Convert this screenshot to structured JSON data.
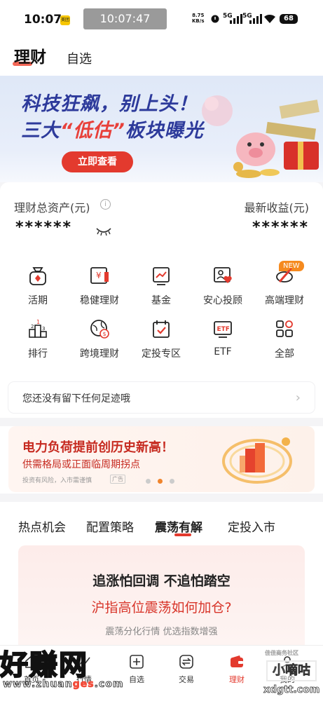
{
  "status_bar": {
    "time": "10:07",
    "badge": "美团",
    "clock_pill": "10:07:47",
    "net_speed_value": "8.75",
    "net_speed_unit": "KB/s",
    "sim1": "5G",
    "sim2": "5G",
    "battery": "68"
  },
  "header": {
    "tab_main": "理财",
    "tab_alt": "自选"
  },
  "banner": {
    "line1": "科技狂飙，别上头！",
    "line2_pre": "三大",
    "line2_hl": "“低估”",
    "line2_post": "板块曝光",
    "cta": "立即查看"
  },
  "assets": {
    "label": "理财总资产(元)",
    "value": "******",
    "income_label": "最新收益(元)",
    "income_value": "******"
  },
  "grid": {
    "new_badge": "NEW",
    "items": [
      {
        "label": "活期",
        "icon": "money-bag-icon"
      },
      {
        "label": "稳健理财",
        "icon": "yen-card-icon"
      },
      {
        "label": "基金",
        "icon": "chart-board-icon"
      },
      {
        "label": "安心投顾",
        "icon": "advisor-heart-icon"
      },
      {
        "label": "高端理财",
        "icon": "premium-rocket-icon"
      },
      {
        "label": "排行",
        "icon": "podium-icon"
      },
      {
        "label": "跨境理财",
        "icon": "globe-dollar-icon"
      },
      {
        "label": "定投专区",
        "icon": "calendar-check-icon"
      },
      {
        "label": "ETF",
        "icon": "etf-icon"
      },
      {
        "label": "全部",
        "icon": "all-apps-icon"
      }
    ]
  },
  "footprint": {
    "text": "您还没有留下任何足迹哦"
  },
  "promo": {
    "title": "电力负荷提前创历史新高！",
    "subtitle": "供需格局或正面临周期拐点",
    "disclaimer": "投资有风险，入市需谨慎",
    "ad_tag": "广告",
    "active_dot": 2
  },
  "section": {
    "tabs": [
      "热点机会",
      "配置策略",
      "震荡有解",
      "定投入市"
    ],
    "active_tab": 2,
    "card_title": "追涨怕回调 不追怕踏空",
    "card_subtitle": "沪指高位震荡如何加仓?",
    "card_desc": "震荡分化行情 优选指数增强"
  },
  "bottom_nav": {
    "items": [
      {
        "label": "首页",
        "icon": "home-icon"
      },
      {
        "label": "行情",
        "icon": "market-icon"
      },
      {
        "label": "自选",
        "icon": "add-square-icon"
      },
      {
        "label": "交易",
        "icon": "exchange-icon"
      },
      {
        "label": "理财",
        "icon": "wallet-icon"
      },
      {
        "label": "我的",
        "icon": "profile-icon"
      }
    ],
    "active": 4
  },
  "watermarks": {
    "left_big": "好赚网",
    "left_url_a": "www.zhuan",
    "left_url_b": "ges",
    "left_url_c": ".com",
    "right_top": "佳佳商务社区",
    "right_box": "小嘀咕",
    "right_url": "xdgtt.com"
  },
  "colors": {
    "accent": "#e33a2e",
    "banner_text": "#2d3a9b",
    "orange": "#f0842c"
  }
}
